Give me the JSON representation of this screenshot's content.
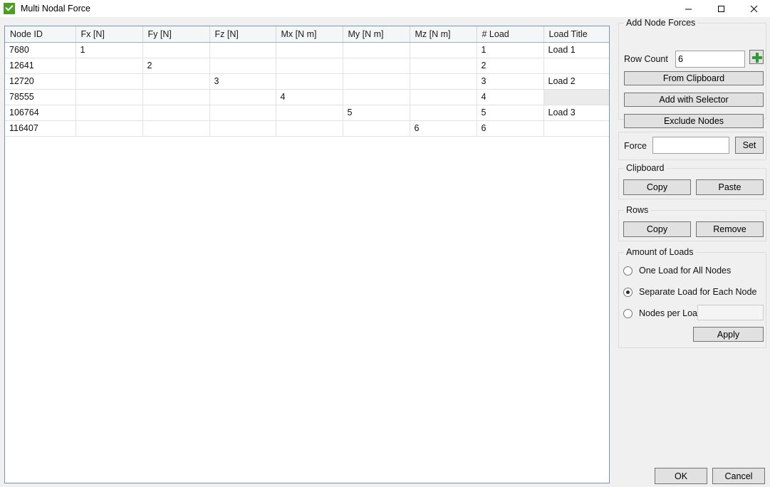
{
  "window": {
    "title": "Multi Nodal Force",
    "icon": "green-check-icon",
    "controls": {
      "minimize": "—",
      "maximize": "□",
      "close": "✕"
    }
  },
  "grid": {
    "columns": [
      "Node ID",
      "Fx  [N]",
      "Fy  [N]",
      "Fz  [N]",
      "Mx  [N m]",
      "My  [N m]",
      "Mz  [N m]",
      "# Load",
      "Load Title"
    ],
    "rows": [
      {
        "node_id": "7680",
        "fx": "1",
        "fy": "",
        "fz": "",
        "mx": "",
        "my": "",
        "mz": "",
        "load": "1",
        "title": "Load 1",
        "title_selected": false
      },
      {
        "node_id": "12641",
        "fx": "",
        "fy": "2",
        "fz": "",
        "mx": "",
        "my": "",
        "mz": "",
        "load": "2",
        "title": "",
        "title_selected": false
      },
      {
        "node_id": "12720",
        "fx": "",
        "fy": "",
        "fz": "3",
        "mx": "",
        "my": "",
        "mz": "",
        "load": "3",
        "title": "Load 2",
        "title_selected": false
      },
      {
        "node_id": "78555",
        "fx": "",
        "fy": "",
        "fz": "",
        "mx": "4",
        "my": "",
        "mz": "",
        "load": "4",
        "title": "",
        "title_selected": true
      },
      {
        "node_id": "106764",
        "fx": "",
        "fy": "",
        "fz": "",
        "mx": "",
        "my": "5",
        "mz": "",
        "load": "5",
        "title": "Load 3",
        "title_selected": false
      },
      {
        "node_id": "116407",
        "fx": "",
        "fy": "",
        "fz": "",
        "mx": "",
        "my": "",
        "mz": "6",
        "load": "6",
        "title": "",
        "title_selected": false
      }
    ]
  },
  "panel": {
    "add_node_forces": {
      "group_title": "Add Node Forces",
      "row_count_label": "Row Count",
      "row_count_value": "6",
      "add_icon": "plus-icon",
      "from_clipboard": "From Clipboard",
      "add_with_selector": "Add with Selector",
      "exclude_nodes": "Exclude Nodes"
    },
    "force": {
      "label": "Force",
      "value": "",
      "set_button": "Set"
    },
    "clipboard": {
      "group_title": "Clipboard",
      "copy": "Copy",
      "paste": "Paste"
    },
    "rows": {
      "group_title": "Rows",
      "copy": "Copy",
      "remove": "Remove"
    },
    "amount_of_loads": {
      "group_title": "Amount of Loads",
      "options": [
        {
          "label": "One Load for All Nodes",
          "selected": false
        },
        {
          "label": "Separate Load for Each Node",
          "selected": true
        },
        {
          "label": "Nodes per Load",
          "selected": false
        }
      ],
      "nodes_per_load_value": "",
      "nodes_per_load_enabled": false,
      "apply": "Apply"
    },
    "dialog": {
      "ok": "OK",
      "cancel": "Cancel"
    }
  },
  "colors": {
    "accent_green": "#4ba024",
    "plus_green": "#2d9a32",
    "grid_border": "#7a95ad",
    "panel_bg": "#f0f0f0",
    "selected_cell": "#ebebeb"
  }
}
